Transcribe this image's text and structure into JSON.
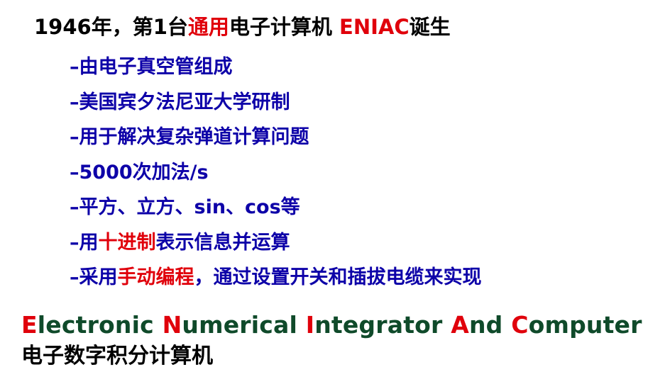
{
  "title": {
    "part1": "1946年，第1台",
    "highlight": "通用",
    "part2": "电子计算机 ",
    "eniac": "ENIAC",
    "part3": "诞生"
  },
  "bullets": [
    {
      "prefix": "–由电子真空管组成",
      "highlight": "",
      "suffix": ""
    },
    {
      "prefix": "–美国宾夕法尼亚大学研制",
      "highlight": "",
      "suffix": ""
    },
    {
      "prefix": "–用于解决复杂弹道计算问题",
      "highlight": "",
      "suffix": ""
    },
    {
      "prefix": "–5000次加法/s",
      "highlight": "",
      "suffix": ""
    },
    {
      "prefix": "–平方、立方、sin、cos等",
      "highlight": "",
      "suffix": ""
    },
    {
      "prefix": "–用",
      "highlight": "十进制",
      "suffix": "表示信息并运算"
    },
    {
      "prefix": "–采用",
      "highlight": "手动编程",
      "suffix": "，通过设置开关和插拔电缆来实现"
    }
  ],
  "english_name": [
    {
      "cap": "E",
      "rest": "lectronic "
    },
    {
      "cap": "N",
      "rest": "umerical "
    },
    {
      "cap": "I",
      "rest": "ntegrator "
    },
    {
      "cap": "A",
      "rest": "nd "
    },
    {
      "cap": "C",
      "rest": "omputer"
    }
  ],
  "chinese_name": "电子数字积分计算机",
  "colors": {
    "black": "#000000",
    "red": "#e0000b",
    "blue": "#0d00a8",
    "green": "#0f4a2a"
  }
}
